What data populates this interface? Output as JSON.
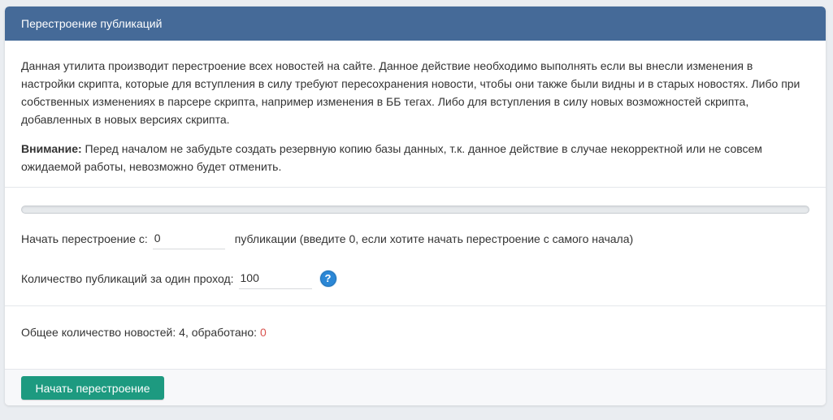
{
  "header": {
    "title": "Перестроение публикаций"
  },
  "description": {
    "paragraph": "Данная утилита производит перестроение всех новостей на сайте. Данное действие необходимо выполнять если вы внесли изменения в настройки скрипта, которые для вступления в силу требуют пересохранения новости, чтобы они также были видны и в старых новостях. Либо при собственных изменениях в парсере скрипта, например изменения в ББ тегах. Либо для вступления в силу новых возможностей скрипта, добавленных в новых версиях скрипта.",
    "warning_label": "Внимание:",
    "warning_text": " Перед началом не забудьте создать резервную копию базы данных, т.к. данное действие в случае некорректной или не совсем ожидаемой работы, невозможно будет отменить."
  },
  "progress": {
    "percent": 0
  },
  "form": {
    "start_label": "Начать перестроение с:",
    "start_value": "0",
    "start_hint": "публикации (введите 0, если хотите начать перестроение с самого начала)",
    "batch_label": "Количество публикаций за один проход:",
    "batch_value": "100",
    "help_icon": "question-circle-icon",
    "help_glyph": "?"
  },
  "totals": {
    "total_label": "Общее количество новостей:",
    "total_count": "4",
    "processed_label": ", обработано:",
    "processed_count": "0"
  },
  "footer": {
    "start_button_label": "Начать перестроение"
  },
  "colors": {
    "header_bg": "#456a98",
    "button_bg": "#1d9a80",
    "processed_color": "#d9534f",
    "help_icon_color": "#2b87d6"
  }
}
